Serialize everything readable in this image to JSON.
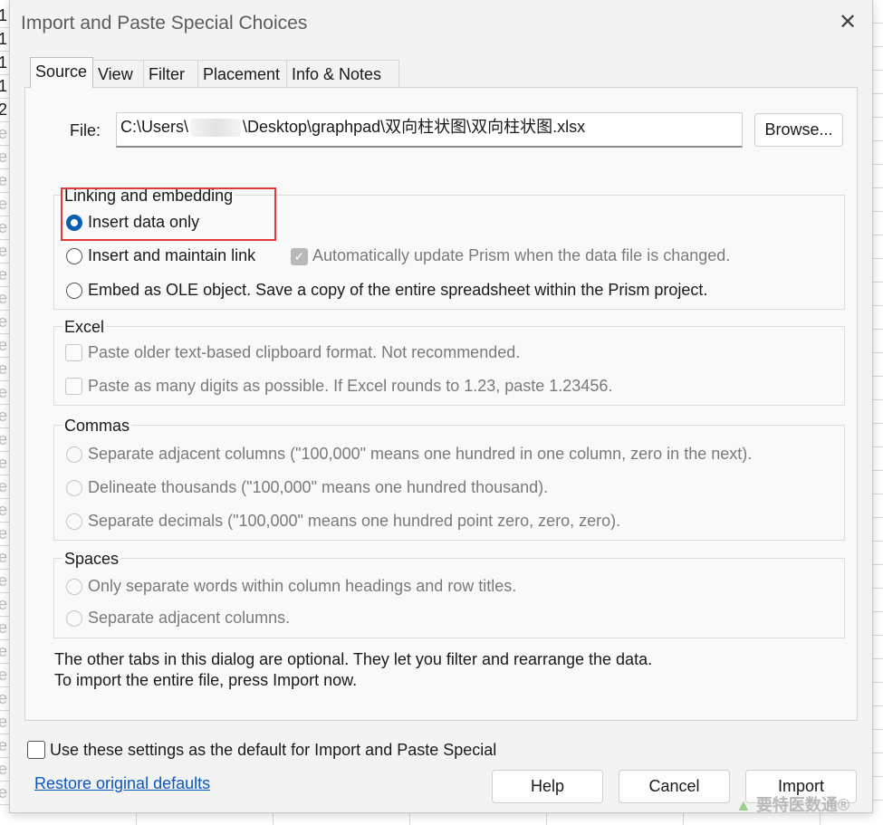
{
  "background_sheet": {
    "cells": [
      "1",
      "1",
      "1",
      "1",
      "2",
      "e",
      "e",
      "e",
      "e",
      "e",
      "e",
      "e",
      "e",
      "e",
      "e",
      "e",
      "e",
      "e",
      "e",
      "e",
      "e",
      "e",
      "e",
      "e",
      "e",
      "e",
      "e",
      "e",
      "e",
      "e",
      "e",
      "e",
      "e",
      "e"
    ]
  },
  "dialog": {
    "title": "Import and Paste Special Choices",
    "close_icon": "close-icon"
  },
  "tabs": [
    {
      "label": "Source",
      "active": true
    },
    {
      "label": "View",
      "active": false
    },
    {
      "label": "Filter",
      "active": false
    },
    {
      "label": "Placement",
      "active": false
    },
    {
      "label": "Info & Notes",
      "active": false
    }
  ],
  "file": {
    "label": "File:",
    "path_prefix": "C:\\Users\\",
    "path_suffix": "\\Desktop\\graphpad\\双向柱状图\\双向柱状图.xlsx",
    "browse_label": "Browse..."
  },
  "linking": {
    "heading": "Linking and embedding",
    "insert_data_only": "Insert data only",
    "insert_maintain_link": "Insert and maintain link",
    "auto_update": "Automatically update Prism when the data file is changed.",
    "embed_ole": "Embed as OLE object. Save a copy of the entire spreadsheet within the Prism project."
  },
  "excel": {
    "heading": "Excel",
    "paste_older": "Paste older text-based clipboard format. Not recommended.",
    "paste_digits": "Paste as many digits as possible. If Excel rounds to 1.23, paste 1.23456."
  },
  "commas": {
    "heading": "Commas",
    "separate_columns": "Separate adjacent columns (\"100,000\" means one hundred in one column, zero in the next).",
    "delineate_thousands": "Delineate thousands (\"100,000\" means one hundred thousand).",
    "separate_decimals": "Separate decimals (\"100,000\" means one hundred point zero, zero, zero)."
  },
  "spaces": {
    "heading": "Spaces",
    "only_words": "Only separate words within column headings and row titles.",
    "separate_columns": "Separate adjacent columns."
  },
  "info": {
    "line1": "The other tabs in this dialog are optional. They let you filter and rearrange the data.",
    "line2": "To import the entire file, press Import now."
  },
  "footer": {
    "default_checkbox": "Use these settings as the default for Import and Paste Special",
    "restore_link": "Restore original defaults",
    "help": "Help",
    "cancel": "Cancel",
    "import": "Import"
  },
  "watermark": {
    "text": "要特医数通®"
  },
  "colors": {
    "accent": "#0a5fb4",
    "highlight": "#e03a3a",
    "link": "#0b57c2"
  }
}
